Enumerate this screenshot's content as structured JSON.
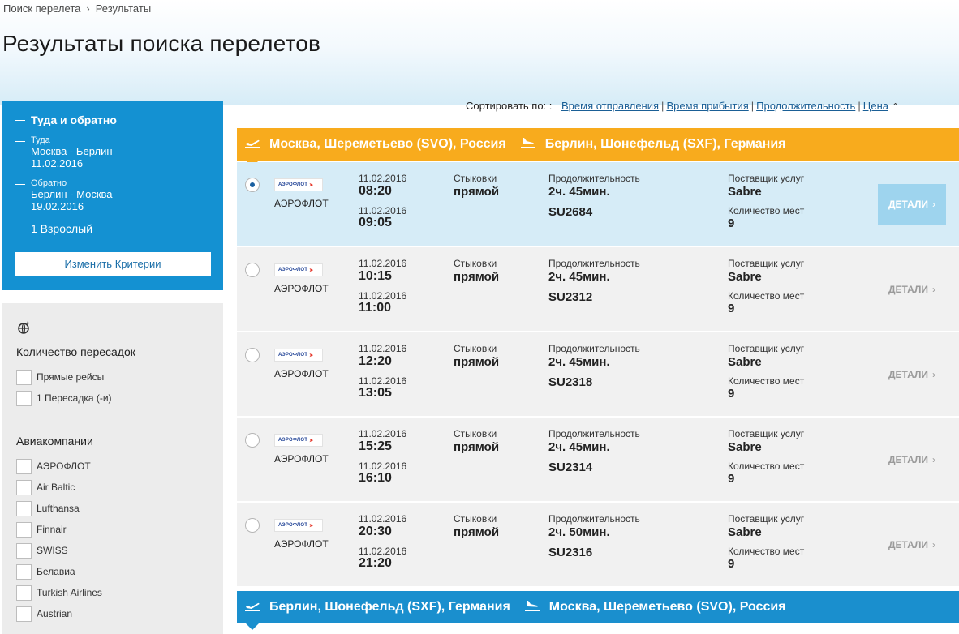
{
  "breadcrumb": {
    "item1": "Поиск перелета",
    "sep": "›",
    "item2": "Результаты"
  },
  "page_title": "Результаты поиска перелетов",
  "criteria": {
    "trip_type": "Туда и обратно",
    "outbound_label": "Туда",
    "outbound_route": "Москва - Берлин",
    "outbound_date": "11.02.2016",
    "return_label": "Обратно",
    "return_route": "Берлин - Москва",
    "return_date": "19.02.2016",
    "passengers": "1 Взрослый",
    "change_button": "Изменить Критерии"
  },
  "filters": {
    "icon": "globe-icon",
    "stops_title": "Количество пересадок",
    "stops": [
      "Прямые рейсы",
      "1 Пересадка (-и)"
    ],
    "airlines_title": "Авиакомпании",
    "airlines": [
      "АЭРОФЛОТ",
      "Air Baltic",
      "Lufthansa",
      "Finnair",
      "SWISS",
      "Белавиа",
      "Turkish Airlines",
      "Austrian"
    ]
  },
  "sort": {
    "label": "Сортировать по: :",
    "options": [
      "Время отправления",
      "Время прибытия",
      "Продолжительность",
      "Цена"
    ],
    "sep": "|",
    "chevron": "^"
  },
  "outbound": {
    "from": "Москва, Шереметьево (SVO), Россия",
    "to": "Берлин, Шонефельд (SXF), Германия",
    "color": "#f8ab1d"
  },
  "return": {
    "from": "Берлин, Шонефельд (SXF), Германия",
    "to": "Москва, Шереметьево (SVO), Россия",
    "color": "#1a8fce"
  },
  "labels": {
    "stops": "Стыковки",
    "duration": "Продолжительность",
    "provider": "Поставщик услуг",
    "seats": "Количество мест",
    "details": "ДЕТАЛИ",
    "details_arrow": "›",
    "logo_text": "АЭРОФЛОТ"
  },
  "flights": [
    {
      "airline": "АЭРОФЛОТ",
      "dep_date": "11.02.2016",
      "dep_time": "08:20",
      "arr_date": "11.02.2016",
      "arr_time": "09:05",
      "stops": "прямой",
      "duration": "2ч. 45мин.",
      "flight": "SU2684",
      "provider": "Sabre",
      "seats": "9",
      "selected": true
    },
    {
      "airline": "АЭРОФЛОТ",
      "dep_date": "11.02.2016",
      "dep_time": "10:15",
      "arr_date": "11.02.2016",
      "arr_time": "11:00",
      "stops": "прямой",
      "duration": "2ч. 45мин.",
      "flight": "SU2312",
      "provider": "Sabre",
      "seats": "9",
      "selected": false
    },
    {
      "airline": "АЭРОФЛОТ",
      "dep_date": "11.02.2016",
      "dep_time": "12:20",
      "arr_date": "11.02.2016",
      "arr_time": "13:05",
      "stops": "прямой",
      "duration": "2ч. 45мин.",
      "flight": "SU2318",
      "provider": "Sabre",
      "seats": "9",
      "selected": false
    },
    {
      "airline": "АЭРОФЛОТ",
      "dep_date": "11.02.2016",
      "dep_time": "15:25",
      "arr_date": "11.02.2016",
      "arr_time": "16:10",
      "stops": "прямой",
      "duration": "2ч. 45мин.",
      "flight": "SU2314",
      "provider": "Sabre",
      "seats": "9",
      "selected": false
    },
    {
      "airline": "АЭРОФЛОТ",
      "dep_date": "11.02.2016",
      "dep_time": "20:30",
      "arr_date": "11.02.2016",
      "arr_time": "21:20",
      "stops": "прямой",
      "duration": "2ч. 50мин.",
      "flight": "SU2316",
      "provider": "Sabre",
      "seats": "9",
      "selected": false
    }
  ]
}
